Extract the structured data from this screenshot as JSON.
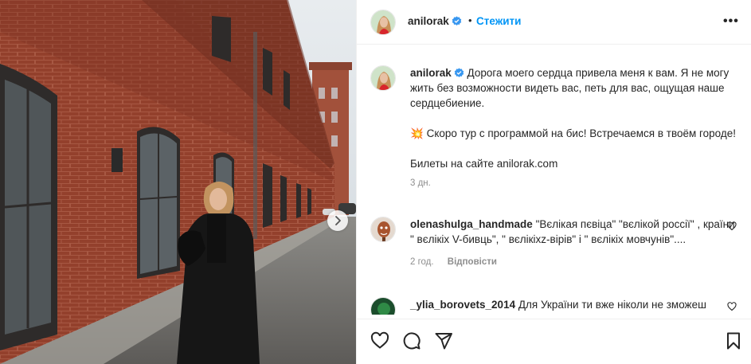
{
  "header": {
    "username": "anilorak",
    "separator": "•",
    "follow_label": "Стежити",
    "more_label": "•••"
  },
  "caption": {
    "username": "anilorak",
    "text1": "Дорога моего сердца привела меня к вам. Я не могу жить без возможности видеть вас, петь для вас, ощущая наше сердцебиение.",
    "emoji": "💥",
    "text2": "Скоро тур с программой на бис! Встречаемся в твоём городе!",
    "text3": "Билеты на сайте anilorak.com",
    "time": "3 дн."
  },
  "comments": [
    {
      "username": "olenashulga_handmade",
      "text": "\"Вєлікая пєвіца\" \"вєлікой россії\" , країни \" вєлікіх V-бивць\", \" вєлікіхz-вірів\" і \" вєлікіх мовчунів\"....",
      "time": "2 год.",
      "reply_label": "Відповісти"
    },
    {
      "username": "_ylia_borovets_2014",
      "text": "Для України ти вже ніколи не зможеш заспівати і побачити своїх колишніх прихильників в Україні!"
    }
  ],
  "icons": {
    "verified": "verified-badge-icon",
    "more": "more-options-icon",
    "next": "chevron-right-icon",
    "like": "heart-icon",
    "comment": "comment-bubble-icon",
    "share": "paper-plane-icon",
    "save": "bookmark-icon"
  },
  "colors": {
    "accent": "#0095f6",
    "text": "#262626",
    "muted": "#8e8e8e",
    "verified": "#3897f0",
    "brick": "#8e3b2a"
  }
}
